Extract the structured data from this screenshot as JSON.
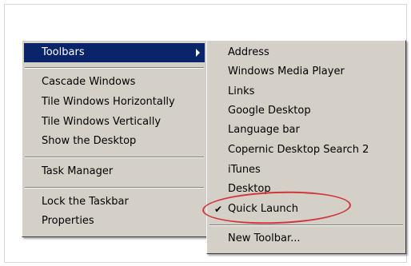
{
  "main_menu": {
    "toolbars": "Toolbars",
    "cascade": "Cascade Windows",
    "tile_h": "Tile Windows Horizontally",
    "tile_v": "Tile Windows Vertically",
    "show_desktop": "Show the Desktop",
    "task_manager": "Task Manager",
    "lock_taskbar": "Lock the Taskbar",
    "properties": "Properties"
  },
  "toolbars_submenu": {
    "items": [
      {
        "label": "Address"
      },
      {
        "label": "Windows Media Player"
      },
      {
        "label": "Links"
      },
      {
        "label": "Google Desktop"
      },
      {
        "label": "Language bar"
      },
      {
        "label": "Copernic Desktop Search 2"
      },
      {
        "label": "iTunes"
      },
      {
        "label": "Desktop"
      },
      {
        "label": "Quick Launch",
        "checked": true
      }
    ],
    "new_toolbar": "New Toolbar..."
  },
  "colors": {
    "menu_background": "#d4d0c8",
    "selection": "#0a246a",
    "annotation_ring": "#d0363a"
  }
}
